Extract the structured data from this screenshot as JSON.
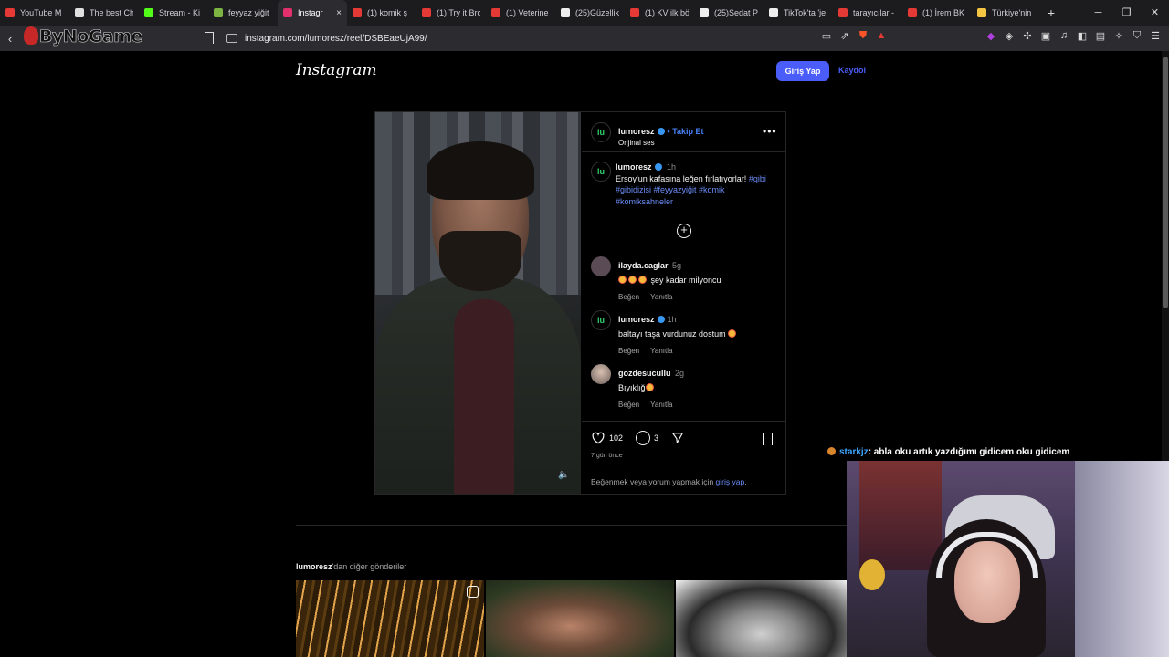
{
  "browser": {
    "tabs": [
      {
        "label": "YouTube M",
        "fav_color": "#e53935"
      },
      {
        "label": "The best Ch",
        "fav_color": "#e0e0e0"
      },
      {
        "label": "Stream - Ki",
        "fav_color": "#53fc18"
      },
      {
        "label": "feyyaz yiğit",
        "fav_color": "#7cb342"
      },
      {
        "label": "Instagr",
        "fav_color": "#e1306c",
        "active": true
      },
      {
        "label": "(1) komik ş",
        "fav_color": "#e53935"
      },
      {
        "label": "(1) Try it Bro",
        "fav_color": "#e53935"
      },
      {
        "label": "(1) Veterine",
        "fav_color": "#e53935"
      },
      {
        "label": "(25)Güzellik",
        "fav_color": "#eeeeee"
      },
      {
        "label": "(1) KV ilk bö",
        "fav_color": "#e53935"
      },
      {
        "label": "(25)Sedat P",
        "fav_color": "#eeeeee"
      },
      {
        "label": "TikTok'ta 'je",
        "fav_color": "#eeeeee"
      },
      {
        "label": "tarayıcılar -",
        "fav_color": "#e53935"
      },
      {
        "label": "(1) İrem BK",
        "fav_color": "#e53935"
      },
      {
        "label": "Türkiye'nin",
        "fav_color": "#f4c542"
      }
    ],
    "close_glyph": "×",
    "new_tab_glyph": "+",
    "url": "instagram.com/lumoresz/reel/DSBEaeUjA99/",
    "watermark": "ByNoGame"
  },
  "instagram": {
    "logo": "Instagram",
    "login_label": "Giriş Yap",
    "signup_label": "Kaydol",
    "post": {
      "owner": "lumoresz",
      "avatar_text": "lu",
      "follow": "• Takip Et",
      "audio": "Orijinal ses",
      "caption_time": "1h",
      "caption_text": "Ersoy'un kafasına leğen fırlatıyorlar!",
      "caption_tags": "#gibi #gibidizisi #feyyazyiğit #komik #komiksahneler",
      "comments": [
        {
          "user": "ilayda.caglar",
          "time": "5g",
          "text": "şey kadar milyoncu",
          "emoji_count": 3,
          "avatar_color": "#5b4b55"
        },
        {
          "user": "lumoresz",
          "time": "1h",
          "text": "baltayı taşa vurdunuz dostum",
          "emoji_after": true,
          "verified": true,
          "avatar_text": "lu"
        },
        {
          "user": "gozdesucullu",
          "time": "2g",
          "text": "Bıyıklığ",
          "emoji_after": true,
          "avatar_color": "#8b7f7c"
        }
      ],
      "like_label": "Beğen",
      "reply_label": "Yanıtla",
      "likes": "102",
      "comment_count": "3",
      "posted_ago": "7 gün önce",
      "login_note": "Beğenmek veya yorum yapmak için",
      "login_link": "giriş yap",
      "login_note_end": "."
    },
    "more_posts_user": "lumoresz",
    "more_posts_suffix": "'dan diğer gönderiler"
  },
  "overlay": {
    "chat_user": "starkjz",
    "chat_message": ": abla oku artık yazdığımı gidicem oku gidicem"
  }
}
